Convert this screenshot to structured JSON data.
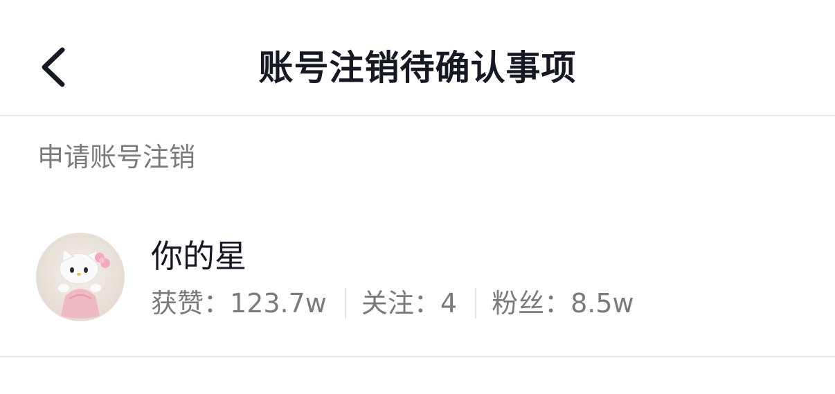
{
  "header": {
    "title": "账号注销待确认事项",
    "back_icon": "chevron-left-icon"
  },
  "section": {
    "label": "申请账号注销"
  },
  "account": {
    "username": "你的星",
    "avatar_icon": "hello-kitty-avatar",
    "stats": [
      {
        "label": "获赞：",
        "value": "123.7w"
      },
      {
        "label": "关注：",
        "value": "4"
      },
      {
        "label": "粉丝：",
        "value": "8.5w"
      }
    ]
  }
}
